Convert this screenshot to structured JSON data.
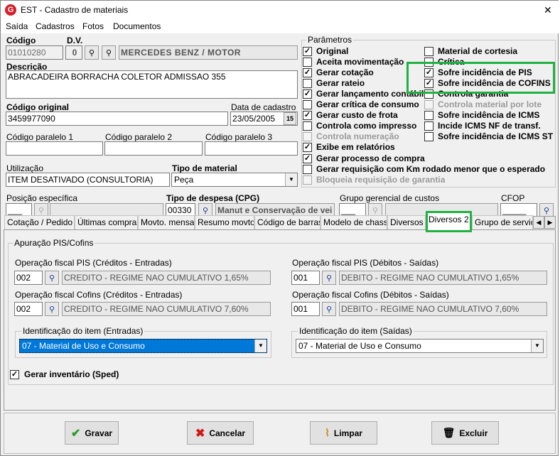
{
  "window": {
    "title": "EST - Cadastro de materiais",
    "close": "✕"
  },
  "menu": [
    "Saída",
    "Cadastros",
    "Fotos",
    "Documentos"
  ],
  "header": {
    "codigo_label": "Código",
    "codigo_value": "01010280",
    "dv_label": "D.V.",
    "dv_value": "0",
    "brand_value": "MERCEDES BENZ / MOTOR",
    "descricao_label": "Descrição",
    "descricao_value": "ABRACADEIRA BORRACHA COLETOR ADMISSAO 355",
    "codigo_original_label": "Código original",
    "codigo_original_value": "3459977090",
    "data_cadastro_label": "Data de cadastro",
    "data_cadastro_value": "23/05/2005",
    "calendar_glyph": "15",
    "cp1_label": "Código paralelo 1",
    "cp2_label": "Código paralelo 2",
    "cp3_label": "Código paralelo 3",
    "utilizacao_label": "Utilização",
    "utilizacao_value": "ITEM DESATIVADO (CONSULTORIA)",
    "tipo_material_label": "Tipo de material",
    "tipo_material_value": "Peça",
    "posicao_label": "Posição específica",
    "posicao_value": "___",
    "tipo_despesa_label": "Tipo de despesa (CPG)",
    "tipo_despesa_code": "00330",
    "tipo_despesa_value": "Manut e Conservação de vei",
    "grupo_label": "Grupo gerencial de custos",
    "grupo_code": "___",
    "cfop_label": "CFOP",
    "cfop_value": "_____"
  },
  "params": {
    "title": "Parâmetros",
    "left": [
      {
        "label": "Original",
        "checked": true,
        "enabled": true
      },
      {
        "label": "Aceita movimentação",
        "checked": false,
        "enabled": true
      },
      {
        "label": "Gerar cotação",
        "checked": true,
        "enabled": true
      },
      {
        "label": "Gerar rateio",
        "checked": false,
        "enabled": true
      },
      {
        "label": "Gerar lançamento contábil",
        "checked": true,
        "enabled": true
      },
      {
        "label": "Gerar crítica de consumo",
        "checked": false,
        "enabled": true
      },
      {
        "label": "Gerar custo de frota",
        "checked": true,
        "enabled": true
      },
      {
        "label": "Controla como impresso",
        "checked": false,
        "enabled": true
      },
      {
        "label": "Controla numeração",
        "checked": false,
        "enabled": false
      },
      {
        "label": "Exibe em relatórios",
        "checked": true,
        "enabled": true
      },
      {
        "label": "Gerar processo de compra",
        "checked": true,
        "enabled": true
      },
      {
        "label": "Gerar requisição com Km rodado menor que o esperado",
        "checked": false,
        "enabled": true
      },
      {
        "label": "Bloqueia requisição de garantia",
        "checked": false,
        "enabled": false
      }
    ],
    "right": [
      {
        "label": "Material de cortesia",
        "checked": false,
        "enabled": true
      },
      {
        "label": "Crítica",
        "checked": false,
        "enabled": true
      },
      {
        "label": "Sofre incidência de PIS",
        "checked": true,
        "enabled": true
      },
      {
        "label": "Sofre incidência de COFINS",
        "checked": true,
        "enabled": true
      },
      {
        "label": "Controla garantia",
        "checked": false,
        "enabled": true
      },
      {
        "label": "Controla material por lote",
        "checked": false,
        "enabled": false
      },
      {
        "label": "Sofre incidência de ICMS",
        "checked": false,
        "enabled": true
      },
      {
        "label": "Incide ICMS NF de transf.",
        "checked": false,
        "enabled": true
      },
      {
        "label": "Sofre incidência de ICMS ST",
        "checked": false,
        "enabled": true
      }
    ]
  },
  "tabs": [
    "Cotação / Pedido",
    "Últimas compras",
    "Movto. mensal",
    "Resumo movto.",
    "Código de barras",
    "Modelo de chassi",
    "Diversos",
    "Diversos 2",
    "Grupo de serviço"
  ],
  "active_tab": "Diversos 2",
  "diversos2": {
    "group_title": "Apuração PIS/Cofins",
    "pis_in_label": "Operação fiscal PIS (Créditos - Entradas)",
    "pis_in_code": "002",
    "pis_in_desc": "CREDITO - REGIME NAO CUMULATIVO 1,65%",
    "cofins_in_label": "Operação fiscal Cofins (Créditos - Entradas)",
    "cofins_in_code": "002",
    "cofins_in_desc": "CREDITO - REGIME NAO CUMULATIVO 7,60%",
    "pis_out_label": "Operação fiscal PIS (Débitos - Saídas)",
    "pis_out_code": "001",
    "pis_out_desc": "DEBITO - REGIME NAO CUMULATIVO 1,65%",
    "cofins_out_label": "Operação fiscal Cofins (Débitos - Saídas)",
    "cofins_out_code": "001",
    "cofins_out_desc": "DEBITO - REGIME NAO CUMULATIVO 7,60%",
    "id_in_label": "Identificação do item (Entradas)",
    "id_in_value": "07 - Material de Uso e Consumo",
    "id_out_label": "Identificação do item (Saídas)",
    "id_out_value": "07 - Material de Uso e Consumo",
    "inventario_label": "Gerar inventário (Sped)"
  },
  "buttons": {
    "gravar": "Gravar",
    "cancelar": "Cancelar",
    "limpar": "Limpar",
    "excluir": "Excluir"
  },
  "colors": {
    "highlight": "#1fb241",
    "selection": "#0078d7"
  }
}
